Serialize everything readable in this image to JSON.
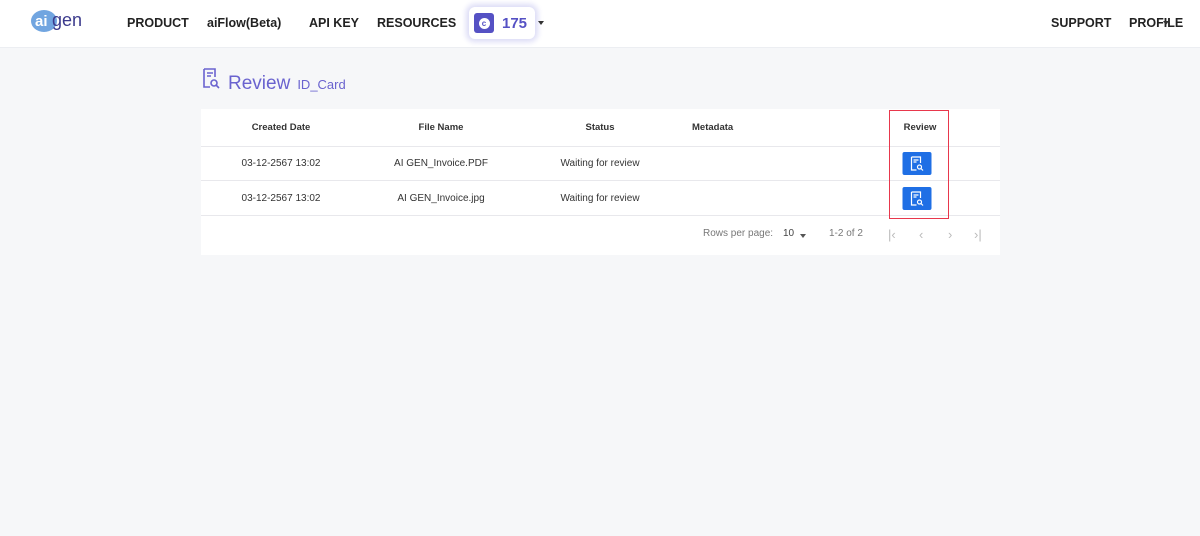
{
  "header": {
    "logo": "aigen",
    "nav": [
      "PRODUCT",
      "aiFlow(Beta)",
      "API KEY",
      "RESOURCES"
    ],
    "credits": "175",
    "support": "SUPPORT",
    "profile": "PROFILE"
  },
  "page": {
    "title": "Review",
    "subtitle": "ID_Card"
  },
  "table": {
    "columns": [
      "Created Date",
      "File Name",
      "Status",
      "Metadata",
      "Review"
    ],
    "rows": [
      {
        "date": "03-12-2567 13:02",
        "file": "AI GEN_Invoice.PDF",
        "status": "Waiting for review",
        "metadata": ""
      },
      {
        "date": "03-12-2567 13:02",
        "file": "AI GEN_Invoice.jpg",
        "status": "Waiting for review",
        "metadata": ""
      }
    ]
  },
  "pagination": {
    "rows_label": "Rows per page:",
    "rows_value": "10",
    "range": "1-2 of 2"
  },
  "colors": {
    "accent": "#6a63cf",
    "button": "#1f6fe5",
    "highlight": "#e8374c"
  }
}
